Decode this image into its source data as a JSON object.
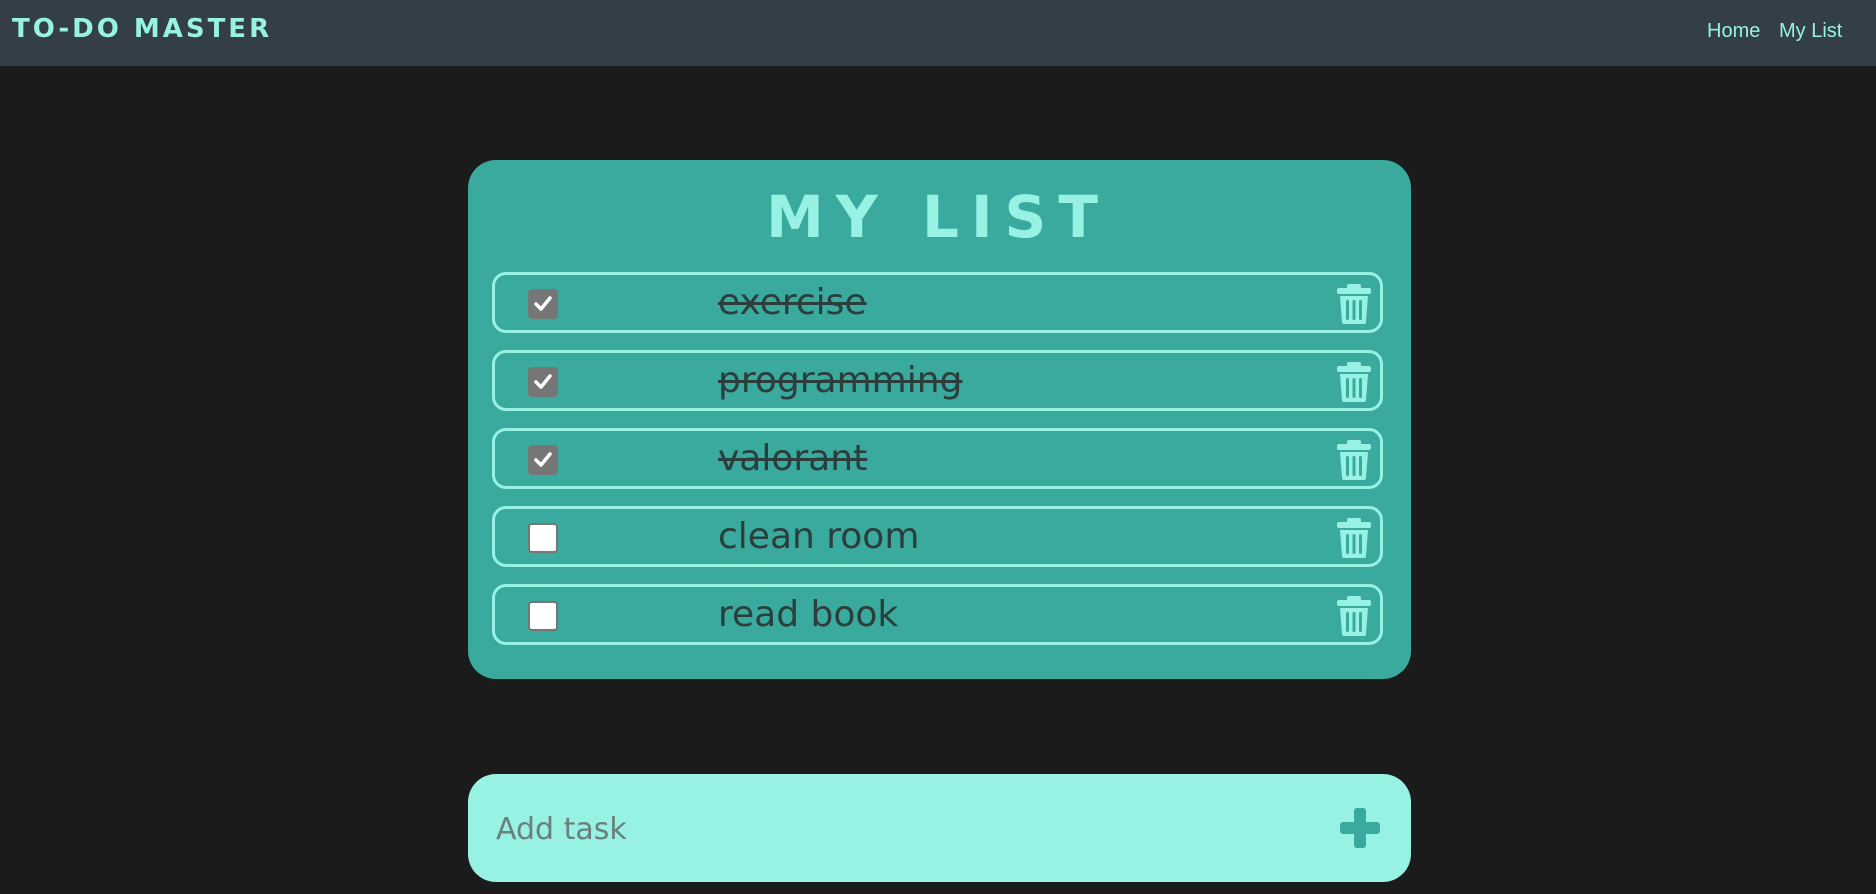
{
  "navbar": {
    "brand": "TO-DO MASTER",
    "links": [
      {
        "label": "Home"
      },
      {
        "label": "My List"
      }
    ]
  },
  "list": {
    "title": "MY LIST",
    "tasks": [
      {
        "text": "exercise",
        "done": true
      },
      {
        "text": "programming",
        "done": true
      },
      {
        "text": "valorant",
        "done": true
      },
      {
        "text": "clean room",
        "done": false
      },
      {
        "text": "read book",
        "done": false
      }
    ]
  },
  "add_task": {
    "placeholder": "Add task",
    "button_icon": "plus-icon"
  },
  "colors": {
    "background": "#1b1b1b",
    "navbar": "#343e46",
    "accent": "#97f2e3",
    "card": "#39aa9d",
    "text_dark": "#2c3e3c"
  }
}
